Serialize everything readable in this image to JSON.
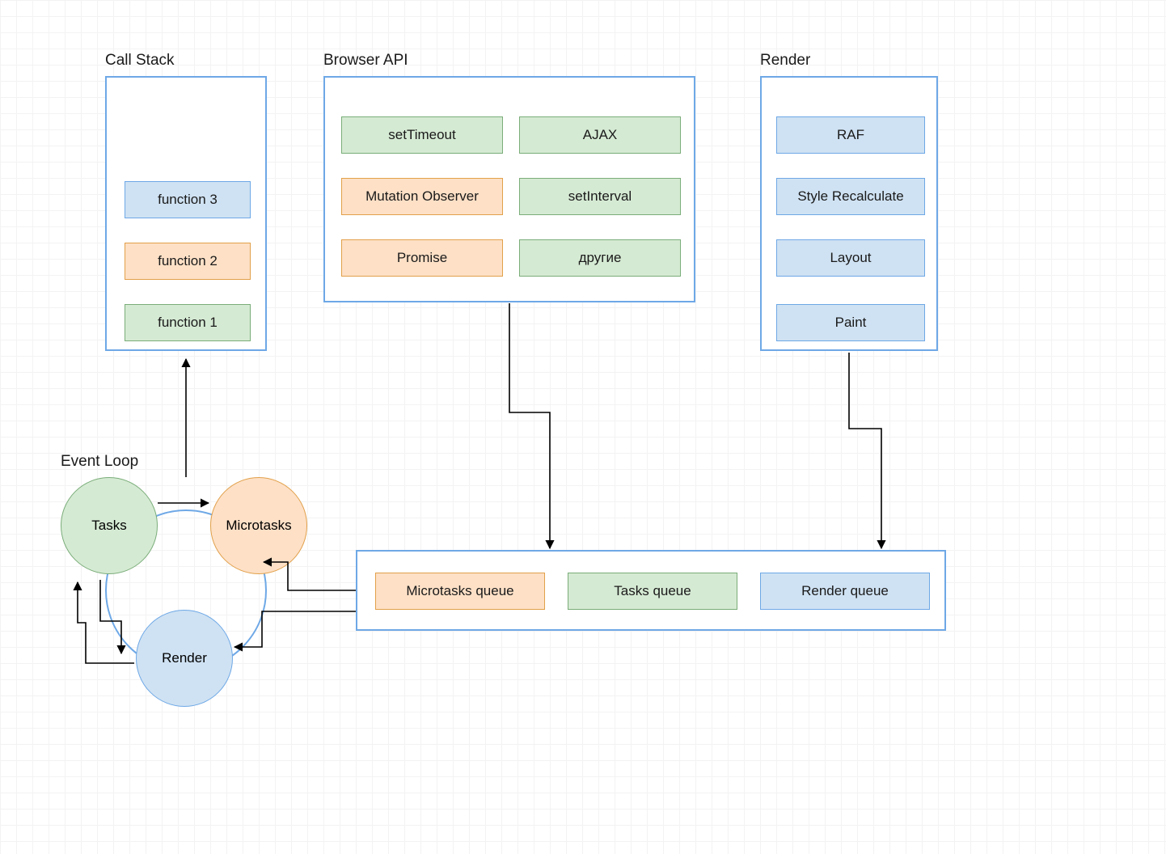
{
  "labels": {
    "call_stack": "Call Stack",
    "browser_api": "Browser API",
    "render": "Render",
    "event_loop": "Event Loop"
  },
  "call_stack": {
    "items": [
      "function 3",
      "function 2",
      "function 1"
    ]
  },
  "browser_api": {
    "grid": [
      [
        "setTimeout",
        "AJAX"
      ],
      [
        "Mutation Observer",
        "setInterval"
      ],
      [
        "Promise",
        "другие"
      ]
    ]
  },
  "render_pipeline": [
    "RAF",
    "Style Recalculate",
    "Layout",
    "Paint"
  ],
  "event_loop": {
    "tasks": "Tasks",
    "microtasks": "Microtasks",
    "render": "Render"
  },
  "queues": {
    "microtasks": "Microtasks queue",
    "tasks": "Tasks queue",
    "render": "Render queue"
  },
  "colors": {
    "blue_fill": "#cfe2f3",
    "blue_border": "#6ea8e6",
    "green_fill": "#d5ead3",
    "green_border": "#7aad79",
    "orange_fill": "#fde0c6",
    "orange_border": "#e2a04a"
  }
}
